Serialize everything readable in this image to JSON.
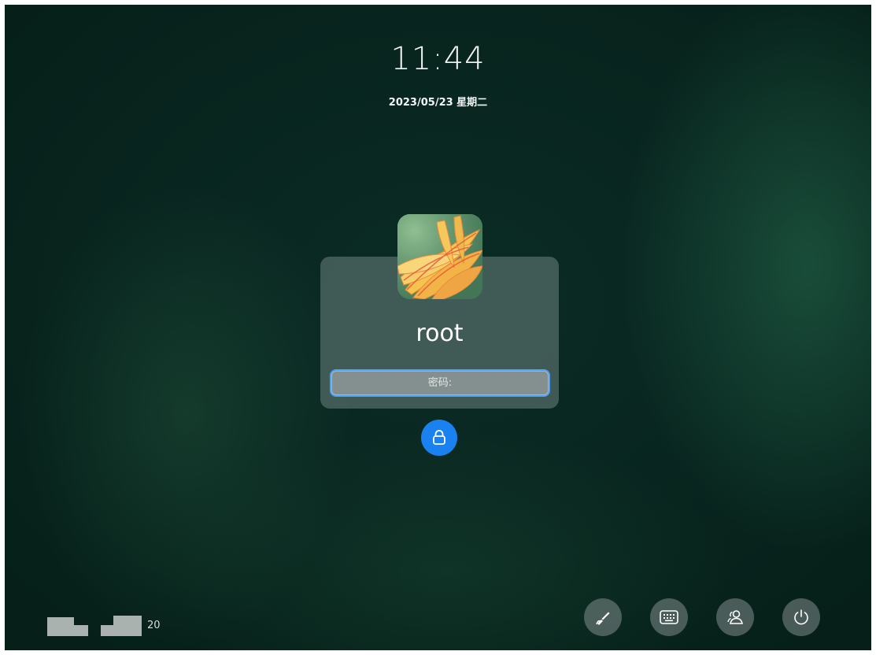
{
  "clock": {
    "time": "11:44",
    "date": "2023/05/23 星期二"
  },
  "user": {
    "name": "root"
  },
  "password": {
    "placeholder": "密码:",
    "value": ""
  },
  "indicator": {
    "label": "20"
  },
  "icons": {
    "avatar": "flower-avatar",
    "unlock": "lock-icon",
    "tray": [
      "brush-icon",
      "keyboard-icon",
      "switch-user-icon",
      "power-icon"
    ]
  },
  "colors": {
    "accent": "#1a82f0",
    "focus_border": "#4aa3ff",
    "background": "#0b2c26"
  }
}
